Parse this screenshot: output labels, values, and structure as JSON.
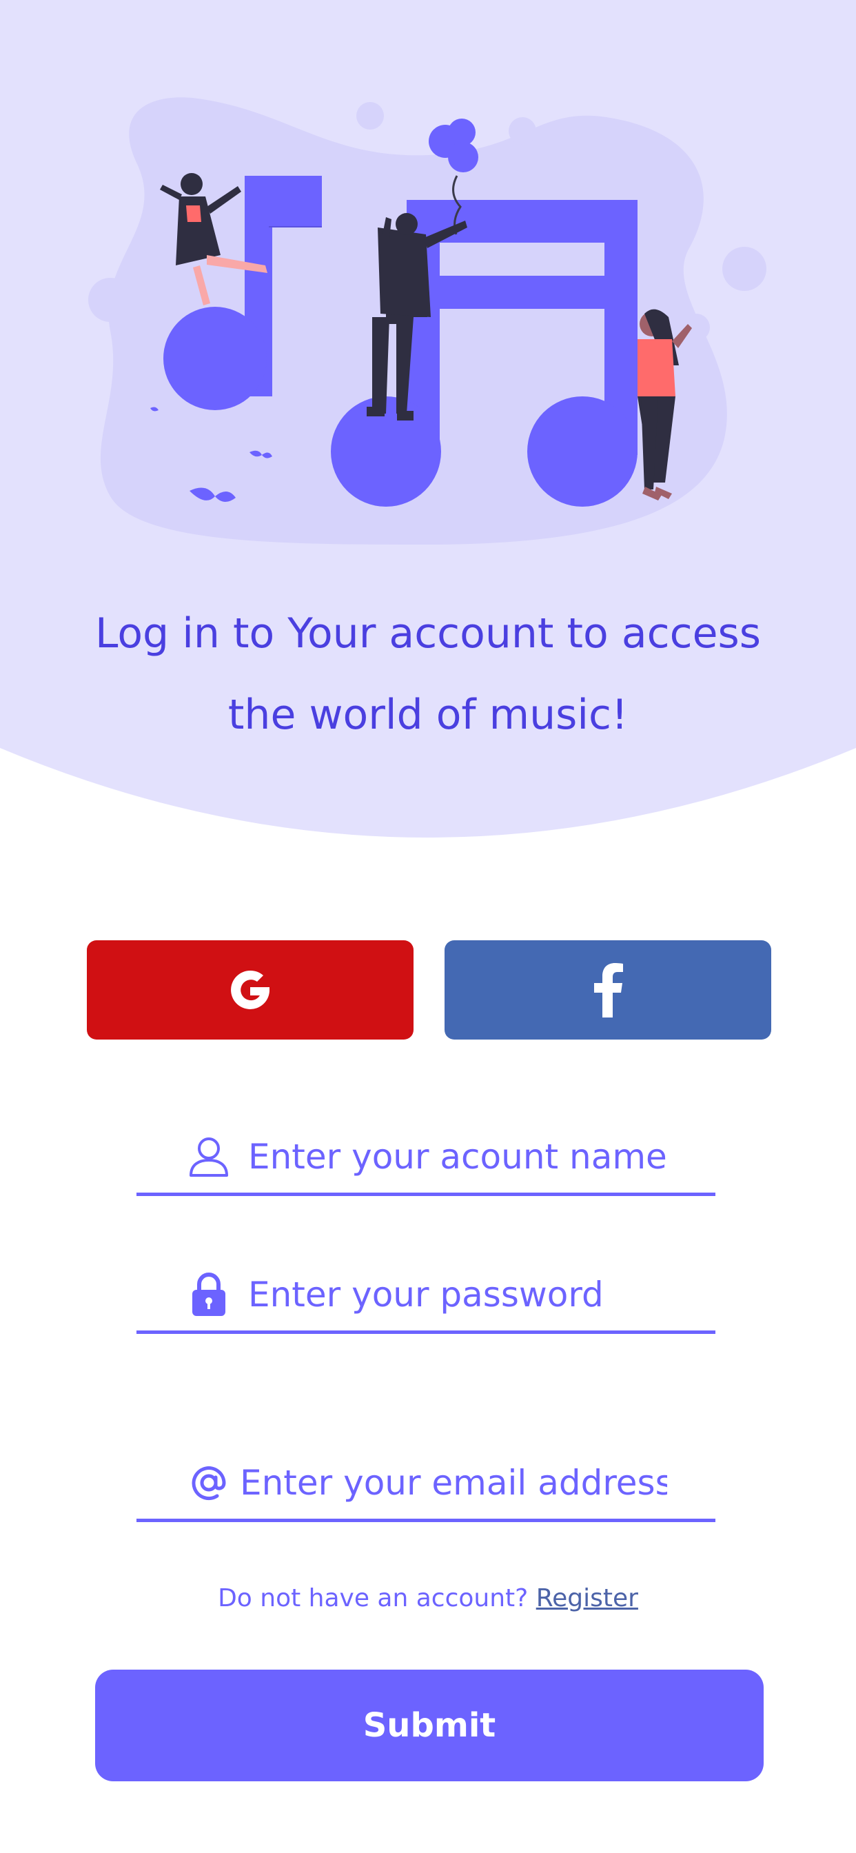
{
  "colors": {
    "hero_bg": "#e3e1fd",
    "blob": "#d6d3fb",
    "accent": "#6c63ff",
    "headline": "#4a3fe0",
    "google_red": "#d01013",
    "facebook_blue": "#4469b3",
    "link": "#4c63a8"
  },
  "hero": {
    "headline_line1": "Log in to Your account to access",
    "headline_line2": "the world of music!"
  },
  "social": {
    "google_icon": "google-g-icon",
    "facebook_icon": "facebook-f-icon"
  },
  "form": {
    "username_placeholder": "Enter your acount name",
    "password_placeholder": "Enter your password",
    "email_placeholder": "Enter your email address",
    "register_prompt": "Do not have an account?",
    "register_link": "Register",
    "submit_label": "Submit"
  }
}
